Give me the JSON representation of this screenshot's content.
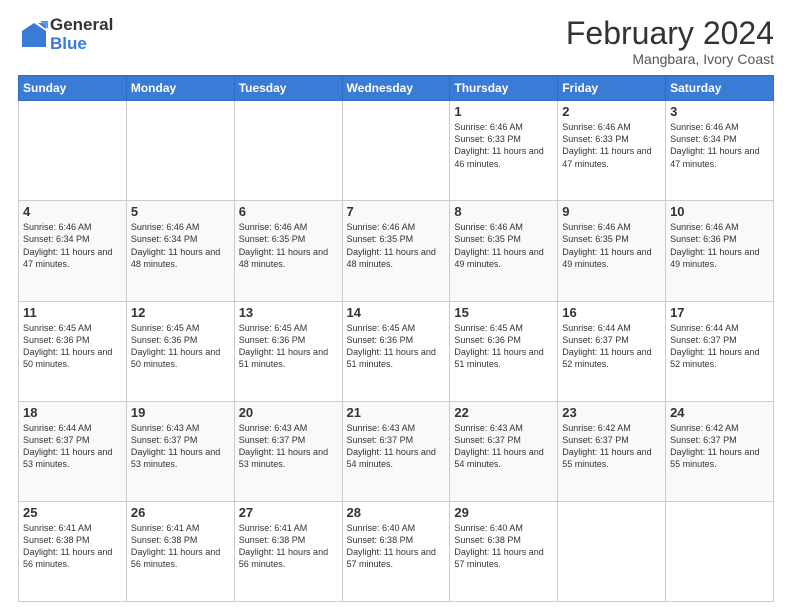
{
  "header": {
    "logo_general": "General",
    "logo_blue": "Blue",
    "month_title": "February 2024",
    "location": "Mangbara, Ivory Coast"
  },
  "days_of_week": [
    "Sunday",
    "Monday",
    "Tuesday",
    "Wednesday",
    "Thursday",
    "Friday",
    "Saturday"
  ],
  "weeks": [
    [
      {
        "day": "",
        "info": ""
      },
      {
        "day": "",
        "info": ""
      },
      {
        "day": "",
        "info": ""
      },
      {
        "day": "",
        "info": ""
      },
      {
        "day": "1",
        "info": "Sunrise: 6:46 AM\nSunset: 6:33 PM\nDaylight: 11 hours\nand 46 minutes."
      },
      {
        "day": "2",
        "info": "Sunrise: 6:46 AM\nSunset: 6:33 PM\nDaylight: 11 hours\nand 47 minutes."
      },
      {
        "day": "3",
        "info": "Sunrise: 6:46 AM\nSunset: 6:34 PM\nDaylight: 11 hours\nand 47 minutes."
      }
    ],
    [
      {
        "day": "4",
        "info": "Sunrise: 6:46 AM\nSunset: 6:34 PM\nDaylight: 11 hours\nand 47 minutes."
      },
      {
        "day": "5",
        "info": "Sunrise: 6:46 AM\nSunset: 6:34 PM\nDaylight: 11 hours\nand 48 minutes."
      },
      {
        "day": "6",
        "info": "Sunrise: 6:46 AM\nSunset: 6:35 PM\nDaylight: 11 hours\nand 48 minutes."
      },
      {
        "day": "7",
        "info": "Sunrise: 6:46 AM\nSunset: 6:35 PM\nDaylight: 11 hours\nand 48 minutes."
      },
      {
        "day": "8",
        "info": "Sunrise: 6:46 AM\nSunset: 6:35 PM\nDaylight: 11 hours\nand 49 minutes."
      },
      {
        "day": "9",
        "info": "Sunrise: 6:46 AM\nSunset: 6:35 PM\nDaylight: 11 hours\nand 49 minutes."
      },
      {
        "day": "10",
        "info": "Sunrise: 6:46 AM\nSunset: 6:36 PM\nDaylight: 11 hours\nand 49 minutes."
      }
    ],
    [
      {
        "day": "11",
        "info": "Sunrise: 6:45 AM\nSunset: 6:36 PM\nDaylight: 11 hours\nand 50 minutes."
      },
      {
        "day": "12",
        "info": "Sunrise: 6:45 AM\nSunset: 6:36 PM\nDaylight: 11 hours\nand 50 minutes."
      },
      {
        "day": "13",
        "info": "Sunrise: 6:45 AM\nSunset: 6:36 PM\nDaylight: 11 hours\nand 51 minutes."
      },
      {
        "day": "14",
        "info": "Sunrise: 6:45 AM\nSunset: 6:36 PM\nDaylight: 11 hours\nand 51 minutes."
      },
      {
        "day": "15",
        "info": "Sunrise: 6:45 AM\nSunset: 6:36 PM\nDaylight: 11 hours\nand 51 minutes."
      },
      {
        "day": "16",
        "info": "Sunrise: 6:44 AM\nSunset: 6:37 PM\nDaylight: 11 hours\nand 52 minutes."
      },
      {
        "day": "17",
        "info": "Sunrise: 6:44 AM\nSunset: 6:37 PM\nDaylight: 11 hours\nand 52 minutes."
      }
    ],
    [
      {
        "day": "18",
        "info": "Sunrise: 6:44 AM\nSunset: 6:37 PM\nDaylight: 11 hours\nand 53 minutes."
      },
      {
        "day": "19",
        "info": "Sunrise: 6:43 AM\nSunset: 6:37 PM\nDaylight: 11 hours\nand 53 minutes."
      },
      {
        "day": "20",
        "info": "Sunrise: 6:43 AM\nSunset: 6:37 PM\nDaylight: 11 hours\nand 53 minutes."
      },
      {
        "day": "21",
        "info": "Sunrise: 6:43 AM\nSunset: 6:37 PM\nDaylight: 11 hours\nand 54 minutes."
      },
      {
        "day": "22",
        "info": "Sunrise: 6:43 AM\nSunset: 6:37 PM\nDaylight: 11 hours\nand 54 minutes."
      },
      {
        "day": "23",
        "info": "Sunrise: 6:42 AM\nSunset: 6:37 PM\nDaylight: 11 hours\nand 55 minutes."
      },
      {
        "day": "24",
        "info": "Sunrise: 6:42 AM\nSunset: 6:37 PM\nDaylight: 11 hours\nand 55 minutes."
      }
    ],
    [
      {
        "day": "25",
        "info": "Sunrise: 6:41 AM\nSunset: 6:38 PM\nDaylight: 11 hours\nand 56 minutes."
      },
      {
        "day": "26",
        "info": "Sunrise: 6:41 AM\nSunset: 6:38 PM\nDaylight: 11 hours\nand 56 minutes."
      },
      {
        "day": "27",
        "info": "Sunrise: 6:41 AM\nSunset: 6:38 PM\nDaylight: 11 hours\nand 56 minutes."
      },
      {
        "day": "28",
        "info": "Sunrise: 6:40 AM\nSunset: 6:38 PM\nDaylight: 11 hours\nand 57 minutes."
      },
      {
        "day": "29",
        "info": "Sunrise: 6:40 AM\nSunset: 6:38 PM\nDaylight: 11 hours\nand 57 minutes."
      },
      {
        "day": "",
        "info": ""
      },
      {
        "day": "",
        "info": ""
      }
    ]
  ]
}
